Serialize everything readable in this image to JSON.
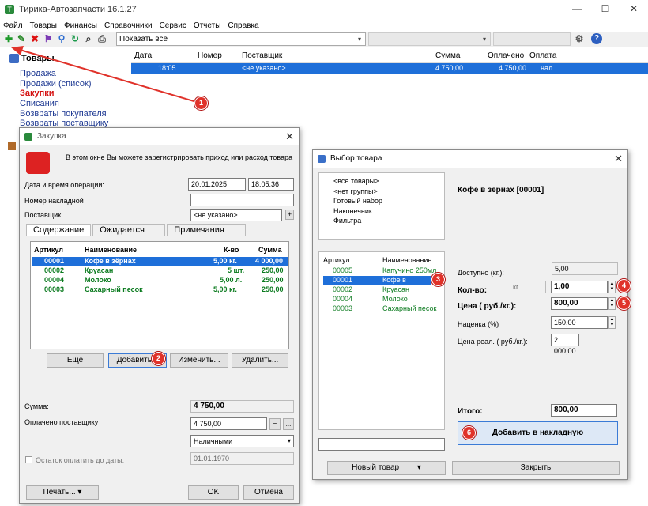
{
  "app": {
    "title": "Тирика-Автозапчасти 16.1.27",
    "win_min": "—",
    "win_max": "☐",
    "win_close": "✕"
  },
  "menu": [
    "Файл",
    "Товары",
    "Финансы",
    "Справочники",
    "Сервис",
    "Отчеты",
    "Справка"
  ],
  "toolbar": {
    "filter_value": "Показать все",
    "filter_arrow": "▾"
  },
  "nav": {
    "header": "Товары",
    "items": [
      "Продажа",
      "Продажи (список)",
      "Закупки",
      "Списания",
      "Возвраты покупателя",
      "Возвраты поставщику"
    ]
  },
  "grid": {
    "columns": [
      "Дата",
      "Номер",
      "Поставщик",
      "Сумма",
      "Оплачено",
      "Оплата"
    ],
    "row": {
      "time": "18:05",
      "supplier": "<не указано>",
      "sum": "4 750,00",
      "paid": "4 750,00",
      "payment": "нал"
    }
  },
  "purchase": {
    "title": "Закупка",
    "info": "В этом окне Вы можете зарегистрировать приход или расход товара",
    "date_label": "Дата и время операции:",
    "date": "20.01.2025",
    "time": "18:05:36",
    "invoice_label": "Номер накладной",
    "supplier_label": "Поставщик",
    "supplier_value": "<не указано>",
    "plus": "+",
    "tabs": [
      "Содержание",
      "Ожидается",
      "Примечания"
    ],
    "table_headers": [
      "Артикул",
      "Наименование",
      "К-во",
      "Сумма"
    ],
    "rows": [
      {
        "code": "00001",
        "name": "Кофе в зёрнах",
        "qty": "5,00 кг.",
        "sum": "4 000,00"
      },
      {
        "code": "00002",
        "name": "Круасан",
        "qty": "5 шт.",
        "sum": "250,00"
      },
      {
        "code": "00004",
        "name": "Молоко",
        "qty": "5,00 л.",
        "sum": "250,00"
      },
      {
        "code": "00003",
        "name": "Сахарный песок",
        "qty": "5,00 кг.",
        "sum": "250,00"
      }
    ],
    "btn_more": "Еще",
    "btn_add": "Добавить...",
    "btn_edit": "Изменить...",
    "btn_delete": "Удалить...",
    "sum_label": "Сумма:",
    "sum_value": "4 750,00",
    "paid_label": "Оплачено поставщику",
    "paid_value": "4 750,00",
    "pay_method": "Наличными",
    "remain_label": "Остаток оплатить до даты:",
    "remain_date": "01.01.1970",
    "btn_print": "Печать...",
    "btn_ok": "OK",
    "btn_cancel": "Отмена"
  },
  "select": {
    "title": "Выбор товара",
    "groups": [
      "<все товары>",
      "<нет группы>",
      "Готовый набор",
      "Наконечник",
      "Фильтра"
    ],
    "list_headers": [
      "Артикул",
      "Наименование"
    ],
    "items": [
      {
        "code": "00005",
        "name": "Капучино 250мл"
      },
      {
        "code": "00001",
        "name": "Кофе в зёрнах"
      },
      {
        "code": "00002",
        "name": "Круасан"
      },
      {
        "code": "00004",
        "name": "Молоко"
      },
      {
        "code": "00003",
        "name": "Сахарный песок"
      }
    ],
    "product_title": "Кофе в зёрнах  [00001]",
    "avail_label": "Доступно (кг.):",
    "avail_value": "5,00",
    "qty_label": "Кол-во:",
    "unit": "кг.",
    "qty_value": "1,00",
    "price_label": "Цена ( руб./кг.):",
    "price_value": "800,00",
    "markup_label": "Наценка (%)",
    "markup_value": "150,00",
    "retail_label": "Цена реал. ( руб./кг.):",
    "retail_value": "2 000,00",
    "total_label": "Итого:",
    "total_value": "800,00",
    "btn_add_invoice": "Добавить в накладную",
    "btn_new": "Новый товар",
    "btn_close": "Закрыть"
  },
  "badges": [
    "1",
    "2",
    "3",
    "4",
    "5",
    "6"
  ]
}
